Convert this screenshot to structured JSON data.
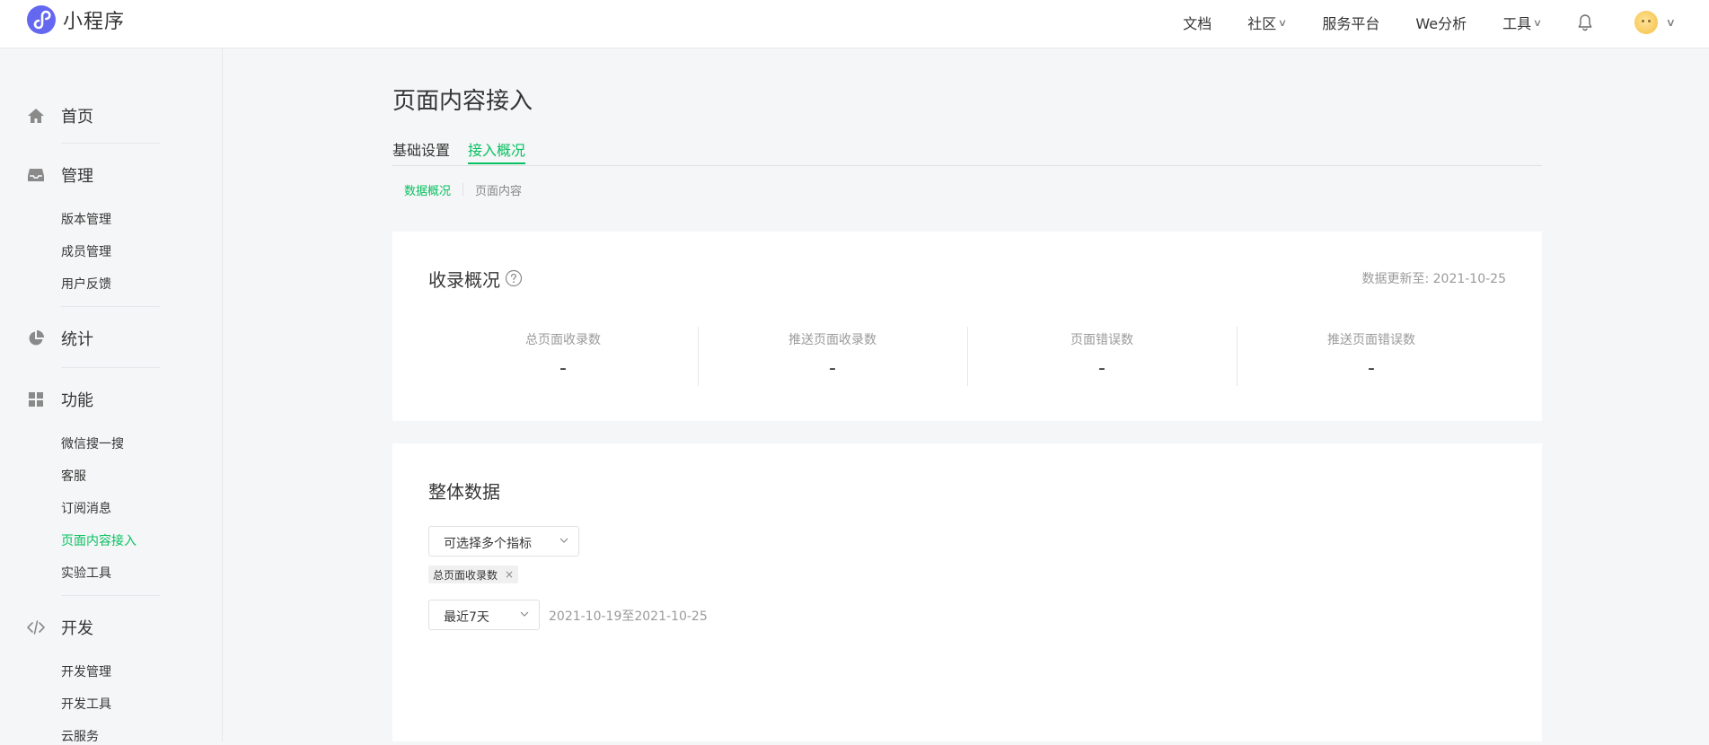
{
  "app": {
    "name": "小程序"
  },
  "topnav": {
    "docs": "文档",
    "community": "社区",
    "service": "服务平台",
    "we_analysis": "We分析",
    "tools": "工具"
  },
  "sidebar": {
    "home": "首页",
    "manage": "管理",
    "manage_items": [
      "版本管理",
      "成员管理",
      "用户反馈"
    ],
    "stats": "统计",
    "features": "功能",
    "features_items": [
      "微信搜一搜",
      "客服",
      "订阅消息",
      "页面内容接入",
      "实验工具"
    ],
    "develop": "开发",
    "develop_items": [
      "开发管理",
      "开发工具",
      "云服务"
    ]
  },
  "page": {
    "title": "页面内容接入"
  },
  "tabs": [
    "基础设置",
    "接入概况"
  ],
  "subtabs": [
    "数据概况",
    "页面内容"
  ],
  "overview": {
    "title": "收录概况",
    "update_label": "数据更新至: ",
    "update_date": "2021-10-25",
    "stats": [
      {
        "label": "总页面收录数",
        "value": "-"
      },
      {
        "label": "推送页面收录数",
        "value": "-"
      },
      {
        "label": "页面错误数",
        "value": "-"
      },
      {
        "label": "推送页面错误数",
        "value": "-"
      }
    ]
  },
  "overall": {
    "title": "整体数据",
    "metric_select": "可选择多个指标",
    "selected_tag": "总页面收录数",
    "range_select": "最近7天",
    "date_range": "2021-10-19至2021-10-25"
  },
  "colors": {
    "accent": "#07c160",
    "brand": "#6467f0"
  }
}
